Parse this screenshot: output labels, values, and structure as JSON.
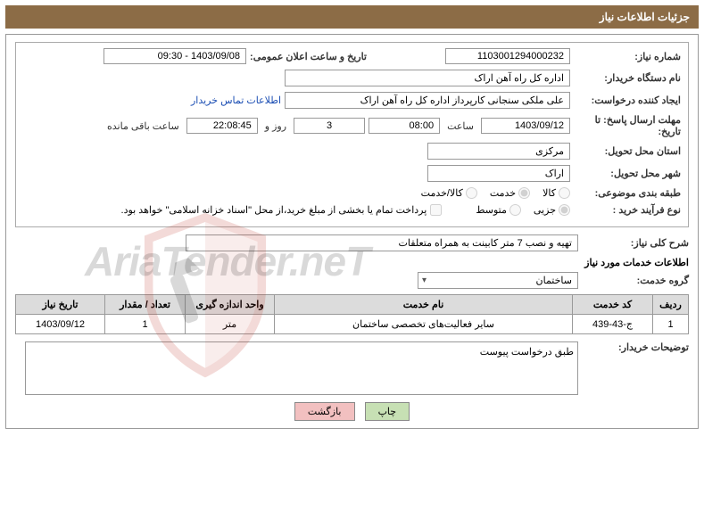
{
  "header": {
    "title": "جزئیات اطلاعات نیاز"
  },
  "need": {
    "number_label": "شماره نیاز:",
    "number": "1103001294000232",
    "announce_label": "تاریخ و ساعت اعلان عمومی:",
    "announce": "1403/09/08 - 09:30",
    "buyer_label": "نام دستگاه خریدار:",
    "buyer": "اداره کل راه آهن اراک",
    "requester_label": "ایجاد کننده درخواست:",
    "requester": "علی ملکی سنجانی کارپرداز اداره کل راه آهن اراک",
    "contact_link": "اطلاعات تماس خریدار",
    "deadline_label1": "مهلت ارسال پاسخ:",
    "deadline_label2": "تاریخ:",
    "deadline_date_to": "تا",
    "deadline_date": "1403/09/12",
    "time_label": "ساعت",
    "deadline_time": "08:00",
    "days": "3",
    "days_label": "روز و",
    "remain_time": "22:08:45",
    "remain_label": "ساعت باقی مانده",
    "province_label": "استان محل تحویل:",
    "province": "مرکزی",
    "city_label": "شهر محل تحویل:",
    "city": "اراک",
    "category_label": "طبقه بندی موضوعی:",
    "cat_goods": "کالا",
    "cat_service": "خدمت",
    "cat_both": "کالا/خدمت",
    "process_label": "نوع فرآیند خرید :",
    "proc_small": "جزیی",
    "proc_medium": "متوسط",
    "payment_note": "پرداخت تمام یا بخشی از مبلغ خرید،از محل \"اسناد خزانه اسلامی\" خواهد بود."
  },
  "description": {
    "title_label": "شرح کلی نیاز:",
    "text": "تهیه و نصب 7 متر کابینت به همراه متعلقات"
  },
  "service_info": {
    "section_title": "اطلاعات خدمات مورد نیاز",
    "group_label": "گروه خدمت:",
    "group": "ساختمان"
  },
  "table": {
    "headers": [
      "ردیف",
      "کد خدمت",
      "نام خدمت",
      "واحد اندازه گیری",
      "تعداد / مقدار",
      "تاریخ نیاز"
    ],
    "row": {
      "index": "1",
      "code": "ج-43-439",
      "name": "سایر فعالیت‌های تخصصی ساختمان",
      "unit": "متر",
      "qty": "1",
      "date": "1403/09/12"
    }
  },
  "notes": {
    "label": "توضیحات خریدار:",
    "text": "طبق درخواست پیوست"
  },
  "buttons": {
    "print": "چاپ",
    "back": "بازگشت"
  },
  "watermark": {
    "text": "AriaTender.neT"
  }
}
